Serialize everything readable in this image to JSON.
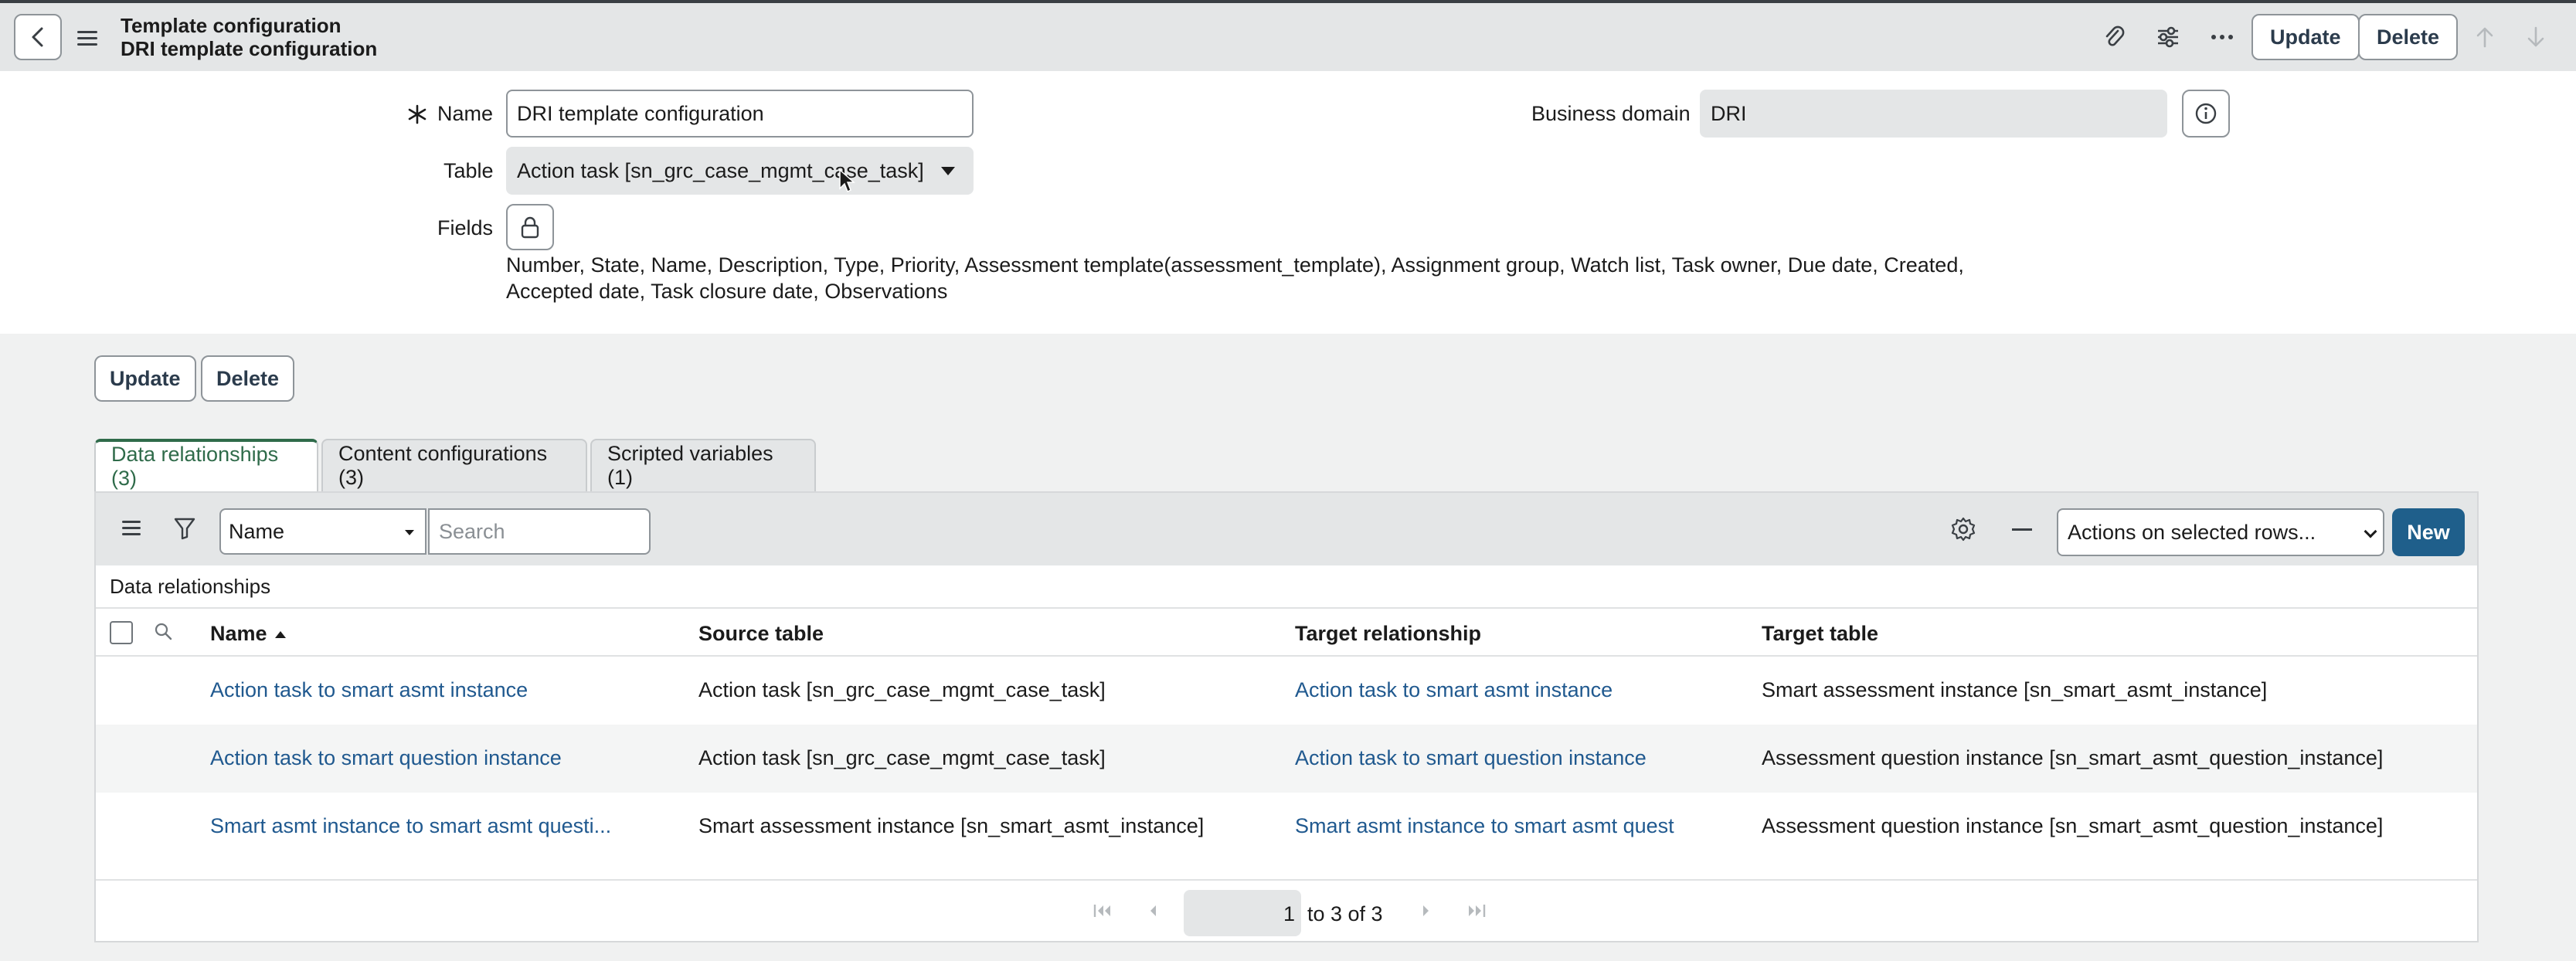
{
  "header": {
    "title": "Template configuration",
    "subtitle": "DRI template configuration",
    "update_label": "Update",
    "delete_label": "Delete"
  },
  "form": {
    "name_label": "Name",
    "name_value": "DRI template configuration",
    "table_label": "Table",
    "table_value": "Action task [sn_grc_case_mgmt_case_task]",
    "fields_label": "Fields",
    "fields_text": "Number, State, Name, Description, Type, Priority, Assessment template(assessment_template), Assignment group, Watch list, Task owner, Due date, Created, Accepted date, Task closure date, Observations",
    "domain_label": "Business domain",
    "domain_value": "DRI"
  },
  "actions": {
    "update_label": "Update",
    "delete_label": "Delete"
  },
  "tabs": [
    {
      "label": "Data relationships (3)",
      "active": true
    },
    {
      "label": "Content configurations (3)",
      "active": false
    },
    {
      "label": "Scripted variables (1)",
      "active": false
    }
  ],
  "list": {
    "field_select": "Name",
    "search_placeholder": "Search",
    "actions_select": "Actions on selected rows...",
    "new_label": "New",
    "caption": "Data relationships",
    "columns": [
      "Name",
      "Source table",
      "Target relationship",
      "Target table"
    ],
    "rows": [
      {
        "name": "Action task to smart asmt instance",
        "source": "Action task [sn_grc_case_mgmt_case_task]",
        "target_rel": "Action task to smart asmt instance",
        "target_table": "Smart assessment instance [sn_smart_asmt_instance]"
      },
      {
        "name": "Action task to smart question instance",
        "source": "Action task [sn_grc_case_mgmt_case_task]",
        "target_rel": "Action task to smart question instance",
        "target_table": "Assessment question instance [sn_smart_asmt_question_instance]"
      },
      {
        "name": "Smart asmt instance to smart asmt questi...",
        "source": "Smart assessment instance [sn_smart_asmt_instance]",
        "target_rel": "Smart asmt instance to smart asmt quest",
        "target_table": "Assessment question instance [sn_smart_asmt_question_instance]"
      }
    ],
    "pager": {
      "page_value": "1",
      "range_text": "to 3 of 3"
    }
  },
  "colors": {
    "primary_button": "#1f5f8b",
    "link": "#20598f",
    "active_tab": "#2f6b4a",
    "header_bg": "#e4e6e7"
  }
}
